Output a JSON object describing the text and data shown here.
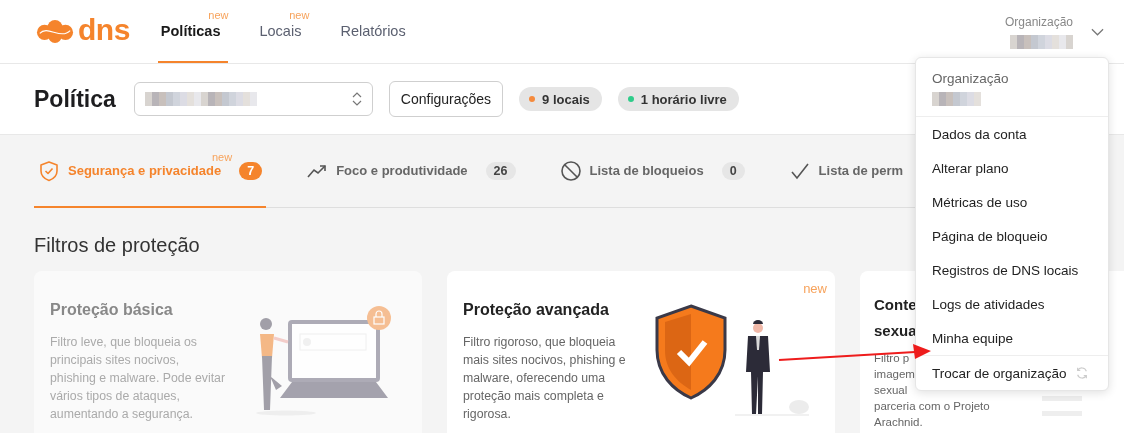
{
  "header": {
    "logo": "dns",
    "nav": [
      {
        "label": "Políticas",
        "selected": true,
        "badge": "new"
      },
      {
        "label": "Locais",
        "selected": false,
        "badge": "new"
      },
      {
        "label": "Relatórios",
        "selected": false
      }
    ],
    "organization": {
      "label": "Organização"
    }
  },
  "toolbar": {
    "title": "Política",
    "settings_button": "Configurações",
    "pills": [
      {
        "label": "9 locais",
        "color": "#f58a3c"
      },
      {
        "label": "1 horário livre",
        "color": "#2ecc8a"
      }
    ]
  },
  "tabs": [
    {
      "kind": "shield",
      "label": "Segurança e privacidade",
      "count": "7",
      "badge": "new",
      "selected": true
    },
    {
      "kind": "trend",
      "label": "Foco e produtividade",
      "count": "26",
      "selected": false
    },
    {
      "kind": "block",
      "label": "Lista de bloqueios",
      "count": "0",
      "selected": false
    },
    {
      "kind": "check",
      "label": "Lista de perm",
      "selected": false
    }
  ],
  "section_title": "Filtros de proteção",
  "cards": [
    {
      "kind": "laptop",
      "title_lines": [
        "Proteção básica"
      ],
      "description_lines": [
        "Filtro leve, que bloqueia os",
        "principais sites nocivos,",
        "phishing e malware. Pode evitar",
        "vários tipos de ataques,",
        "aumentando a segurança."
      ],
      "dimmed": true
    },
    {
      "kind": "shield",
      "title_lines": [
        "Proteção avançada"
      ],
      "description_lines": [
        "Filtro rigoroso, que bloqueia",
        "mais sites nocivos, phishing e",
        "malware, oferecendo uma",
        "proteção mais completa e",
        "rigorosa."
      ],
      "dimmed": false,
      "badge": "new"
    },
    {
      "kind": "lines",
      "title_lines": [
        "Conte",
        "sexua"
      ],
      "description_lines": [
        "Filtro p",
        "imagem",
        "sexual",
        "parceria com o Projeto",
        "Arachnid."
      ],
      "dimmed": false
    }
  ],
  "menu": {
    "header": "Organização",
    "items": [
      {
        "label": "Dados da conta",
        "kind": "link"
      },
      {
        "label": "Alterar plano",
        "kind": "link"
      },
      {
        "label": "Métricas de uso",
        "kind": "link"
      },
      {
        "label": "Página de bloqueio",
        "kind": "link"
      },
      {
        "label": "Registros de DNS locais",
        "kind": "link"
      },
      {
        "label": "Logs de atividades",
        "kind": "link"
      },
      {
        "label": "Minha equipe",
        "kind": "link"
      },
      {
        "label": "Trocar de organização",
        "kind": "switch"
      }
    ]
  }
}
